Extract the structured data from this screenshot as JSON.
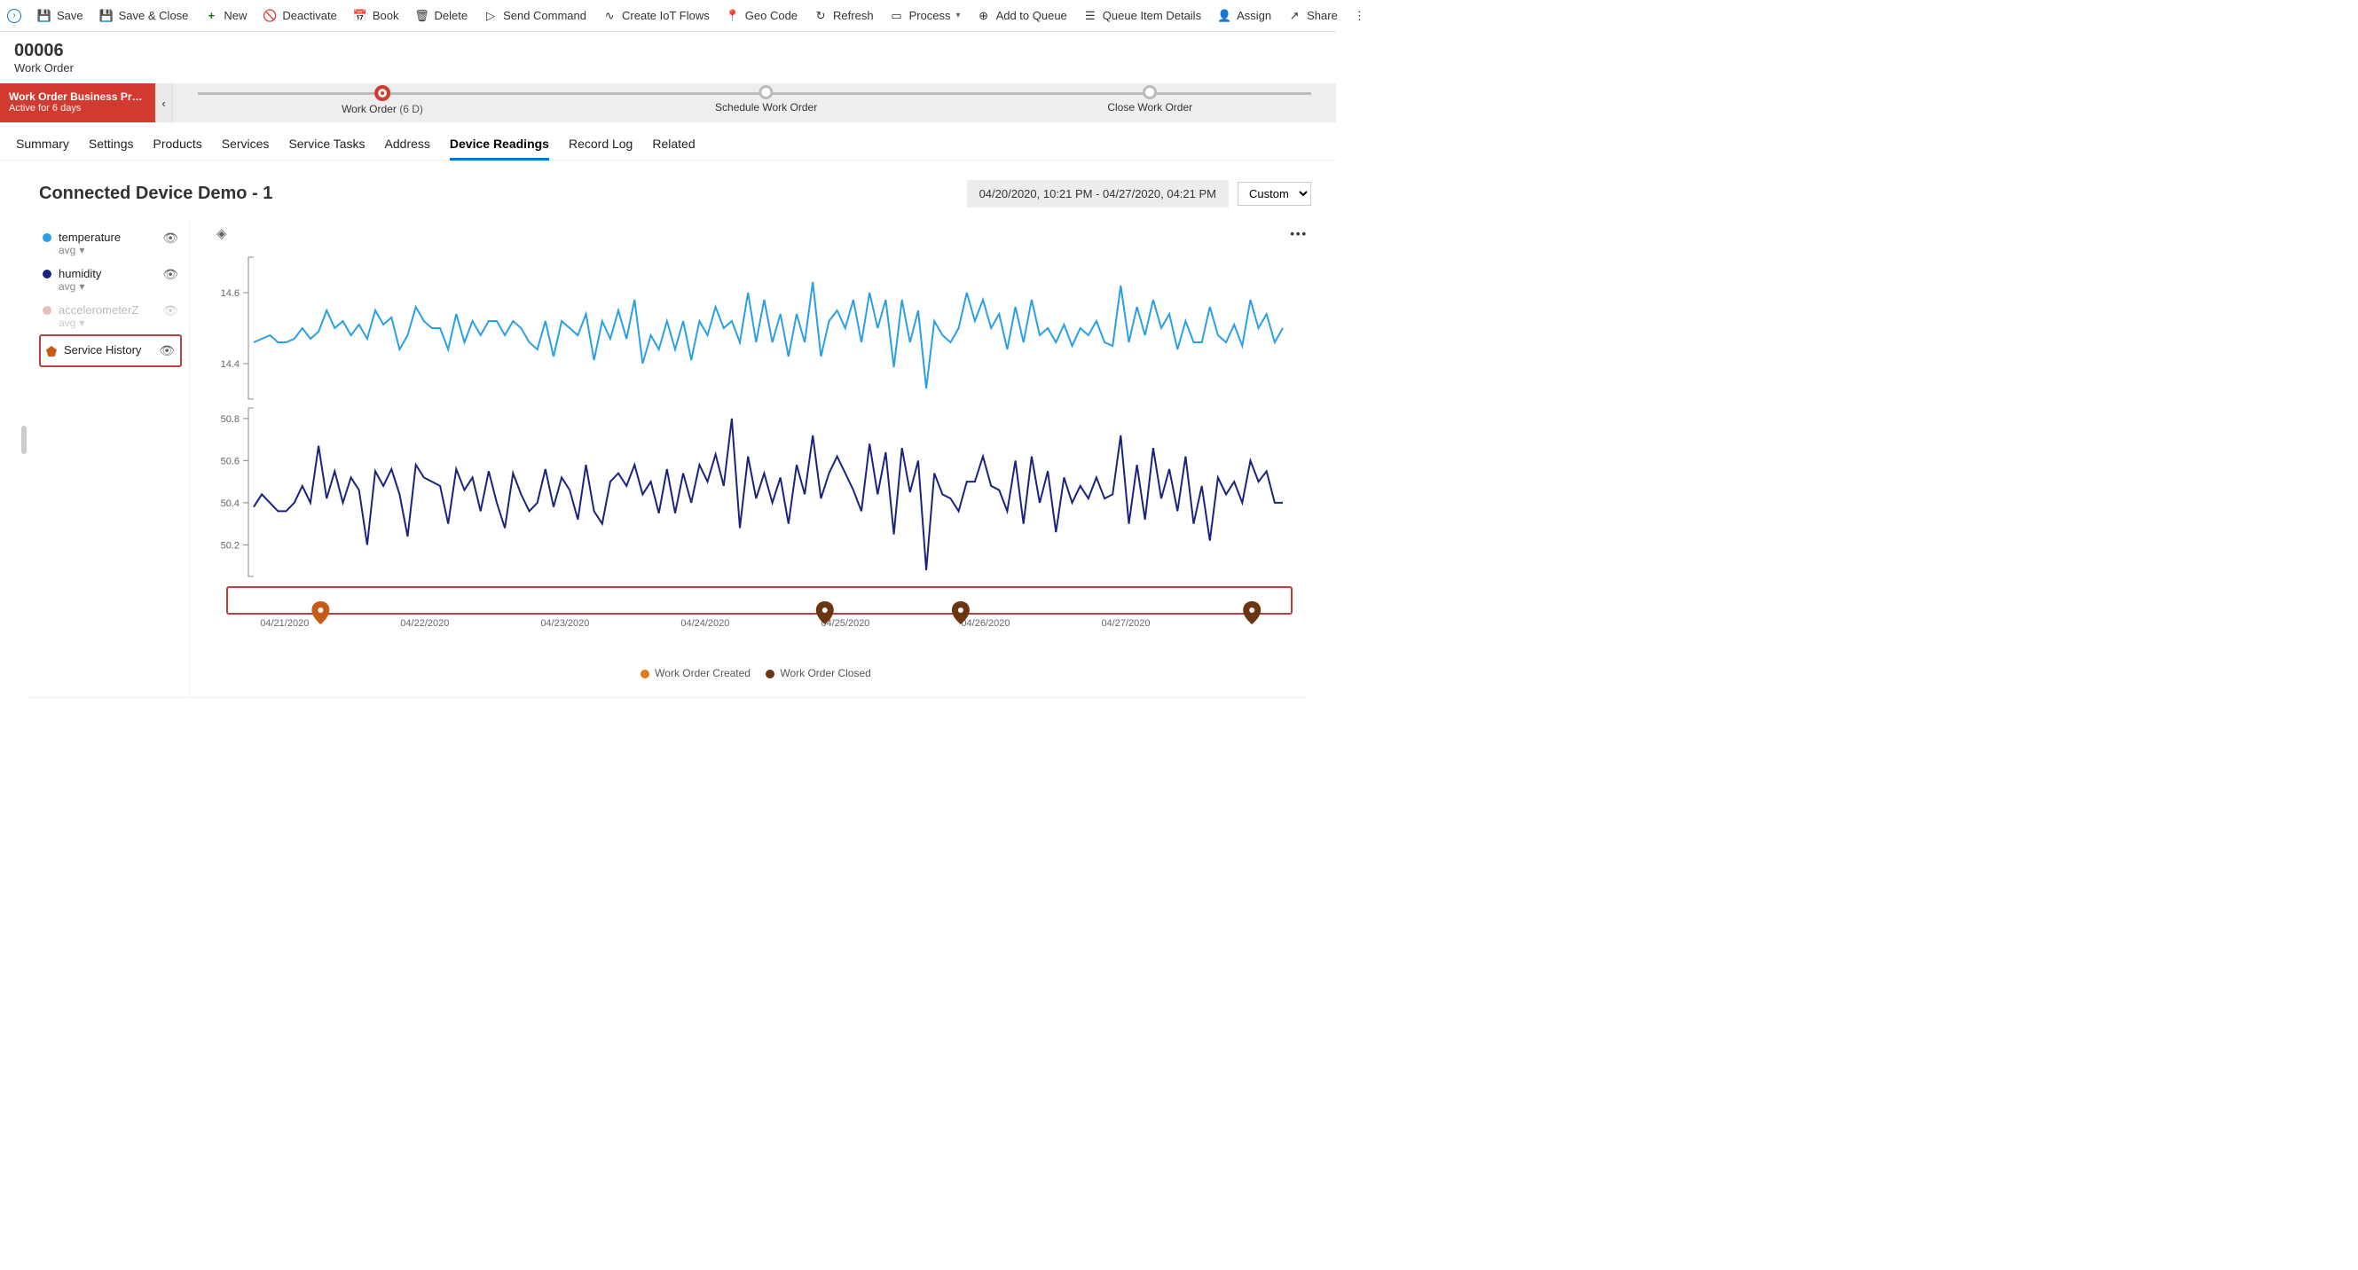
{
  "commandBar": {
    "save": "Save",
    "saveClose": "Save & Close",
    "new": "New",
    "deactivate": "Deactivate",
    "book": "Book",
    "delete": "Delete",
    "sendCommand": "Send Command",
    "createIotFlows": "Create IoT Flows",
    "geoCode": "Geo Code",
    "refresh": "Refresh",
    "process": "Process",
    "addToQueue": "Add to Queue",
    "queueItemDetails": "Queue Item Details",
    "assign": "Assign",
    "share": "Share"
  },
  "header": {
    "title": "00006",
    "subtitle": "Work Order"
  },
  "process": {
    "name": "Work Order Business Pro...",
    "activeFor": "Active for 6 days",
    "stages": [
      {
        "label": "Work Order",
        "duration": "(6 D)",
        "active": true
      },
      {
        "label": "Schedule Work Order",
        "active": false
      },
      {
        "label": "Close Work Order",
        "active": false
      }
    ]
  },
  "tabs": {
    "items": [
      "Summary",
      "Settings",
      "Products",
      "Services",
      "Service Tasks",
      "Address",
      "Device Readings",
      "Record Log",
      "Related"
    ],
    "activeIndex": 6
  },
  "readings": {
    "title": "Connected Device Demo - 1",
    "rangeText": "04/20/2020, 10:21 PM - 04/27/2020, 04:21 PM",
    "rangePreset": "Custom",
    "legend": {
      "temperature": {
        "name": "temperature",
        "agg": "avg",
        "color": "#29a0e6"
      },
      "humidity": {
        "name": "humidity",
        "agg": "avg",
        "color": "#1a237e"
      },
      "accelZ": {
        "name": "accelerometerZ",
        "agg": "avg",
        "color": "#e7bdbb"
      },
      "serviceHistory": {
        "name": "Service History"
      }
    },
    "chartLegend": {
      "created": "Work Order Created",
      "closed": "Work Order Closed"
    }
  },
  "chart_data": [
    {
      "type": "line",
      "title": "temperature (avg)",
      "ylabel": "",
      "ylim": [
        14.3,
        14.7
      ],
      "y_ticks": [
        14.4,
        14.6
      ],
      "x_ticks": [
        "04/21/2020",
        "04/22/2020",
        "04/23/2020",
        "04/24/2020",
        "04/25/2020",
        "04/26/2020",
        "04/27/2020"
      ],
      "series": [
        {
          "name": "temperature",
          "color": "#29a0e6",
          "values": [
            14.46,
            14.47,
            14.48,
            14.46,
            14.46,
            14.47,
            14.5,
            14.47,
            14.49,
            14.55,
            14.5,
            14.52,
            14.48,
            14.51,
            14.47,
            14.55,
            14.51,
            14.53,
            14.44,
            14.48,
            14.56,
            14.52,
            14.5,
            14.5,
            14.44,
            14.54,
            14.46,
            14.52,
            14.48,
            14.52,
            14.52,
            14.48,
            14.52,
            14.5,
            14.46,
            14.44,
            14.52,
            14.42,
            14.52,
            14.5,
            14.48,
            14.54,
            14.41,
            14.52,
            14.47,
            14.55,
            14.47,
            14.58,
            14.4,
            14.48,
            14.44,
            14.52,
            14.44,
            14.52,
            14.41,
            14.52,
            14.48,
            14.56,
            14.5,
            14.52,
            14.46,
            14.6,
            14.46,
            14.58,
            14.46,
            14.54,
            14.42,
            14.54,
            14.46,
            14.63,
            14.42,
            14.52,
            14.55,
            14.5,
            14.58,
            14.46,
            14.6,
            14.5,
            14.58,
            14.39,
            14.58,
            14.46,
            14.55,
            14.33,
            14.52,
            14.48,
            14.46,
            14.5,
            14.6,
            14.52,
            14.58,
            14.5,
            14.54,
            14.44,
            14.56,
            14.46,
            14.58,
            14.48,
            14.5,
            14.46,
            14.51,
            14.45,
            14.5,
            14.48,
            14.52,
            14.46,
            14.45,
            14.62,
            14.46,
            14.56,
            14.48,
            14.58,
            14.5,
            14.54,
            14.44,
            14.52,
            14.46,
            14.46,
            14.56,
            14.48,
            14.46,
            14.51,
            14.45,
            14.58,
            14.5,
            14.54,
            14.46,
            14.5
          ]
        }
      ]
    },
    {
      "type": "line",
      "title": "humidity (avg)",
      "ylabel": "",
      "ylim": [
        50.05,
        50.85
      ],
      "y_ticks": [
        50.2,
        50.4,
        50.6,
        50.8
      ],
      "x_ticks": [
        "04/21/2020",
        "04/22/2020",
        "04/23/2020",
        "04/24/2020",
        "04/25/2020",
        "04/26/2020",
        "04/27/2020"
      ],
      "series": [
        {
          "name": "humidity",
          "color": "#1a237e",
          "values": [
            50.38,
            50.44,
            50.4,
            50.36,
            50.36,
            50.4,
            50.48,
            50.4,
            50.67,
            50.42,
            50.55,
            50.4,
            50.52,
            50.46,
            50.2,
            50.55,
            50.48,
            50.56,
            50.44,
            50.24,
            50.58,
            50.52,
            50.5,
            50.48,
            50.3,
            50.56,
            50.46,
            50.52,
            50.36,
            50.55,
            50.4,
            50.28,
            50.54,
            50.44,
            50.36,
            50.4,
            50.56,
            50.38,
            50.52,
            50.46,
            50.32,
            50.58,
            50.36,
            50.3,
            50.5,
            50.54,
            50.48,
            50.58,
            50.44,
            50.5,
            50.35,
            50.56,
            50.35,
            50.54,
            50.4,
            50.58,
            50.5,
            50.63,
            50.48,
            50.8,
            50.28,
            50.62,
            50.42,
            50.54,
            50.4,
            50.52,
            50.3,
            50.58,
            50.44,
            50.72,
            50.42,
            50.54,
            50.62,
            50.54,
            50.46,
            50.36,
            50.68,
            50.44,
            50.64,
            50.25,
            50.66,
            50.45,
            50.6,
            50.08,
            50.54,
            50.44,
            50.42,
            50.36,
            50.5,
            50.5,
            50.62,
            50.48,
            50.46,
            50.36,
            50.6,
            50.3,
            50.62,
            50.4,
            50.55,
            50.26,
            50.52,
            50.4,
            50.48,
            50.42,
            50.52,
            50.42,
            50.44,
            50.72,
            50.3,
            50.58,
            50.32,
            50.66,
            50.42,
            50.56,
            50.36,
            50.62,
            50.3,
            50.48,
            50.22,
            50.52,
            50.44,
            50.5,
            50.4,
            50.6,
            50.5,
            50.55,
            50.4,
            50.4
          ]
        }
      ]
    },
    {
      "type": "scatter",
      "title": "Service History markers",
      "x_range": [
        "04/20/2020 22:21",
        "04/27/2020 16:21"
      ],
      "series": [
        {
          "name": "Work Order Created",
          "color": "#e27a17",
          "x": [
            "04/21/2020 05:00"
          ]
        },
        {
          "name": "Work Order Closed",
          "color": "#6b3511",
          "x": [
            "04/24/2020 18:00",
            "04/25/2020 15:00",
            "04/27/2020 12:00"
          ]
        }
      ]
    }
  ]
}
